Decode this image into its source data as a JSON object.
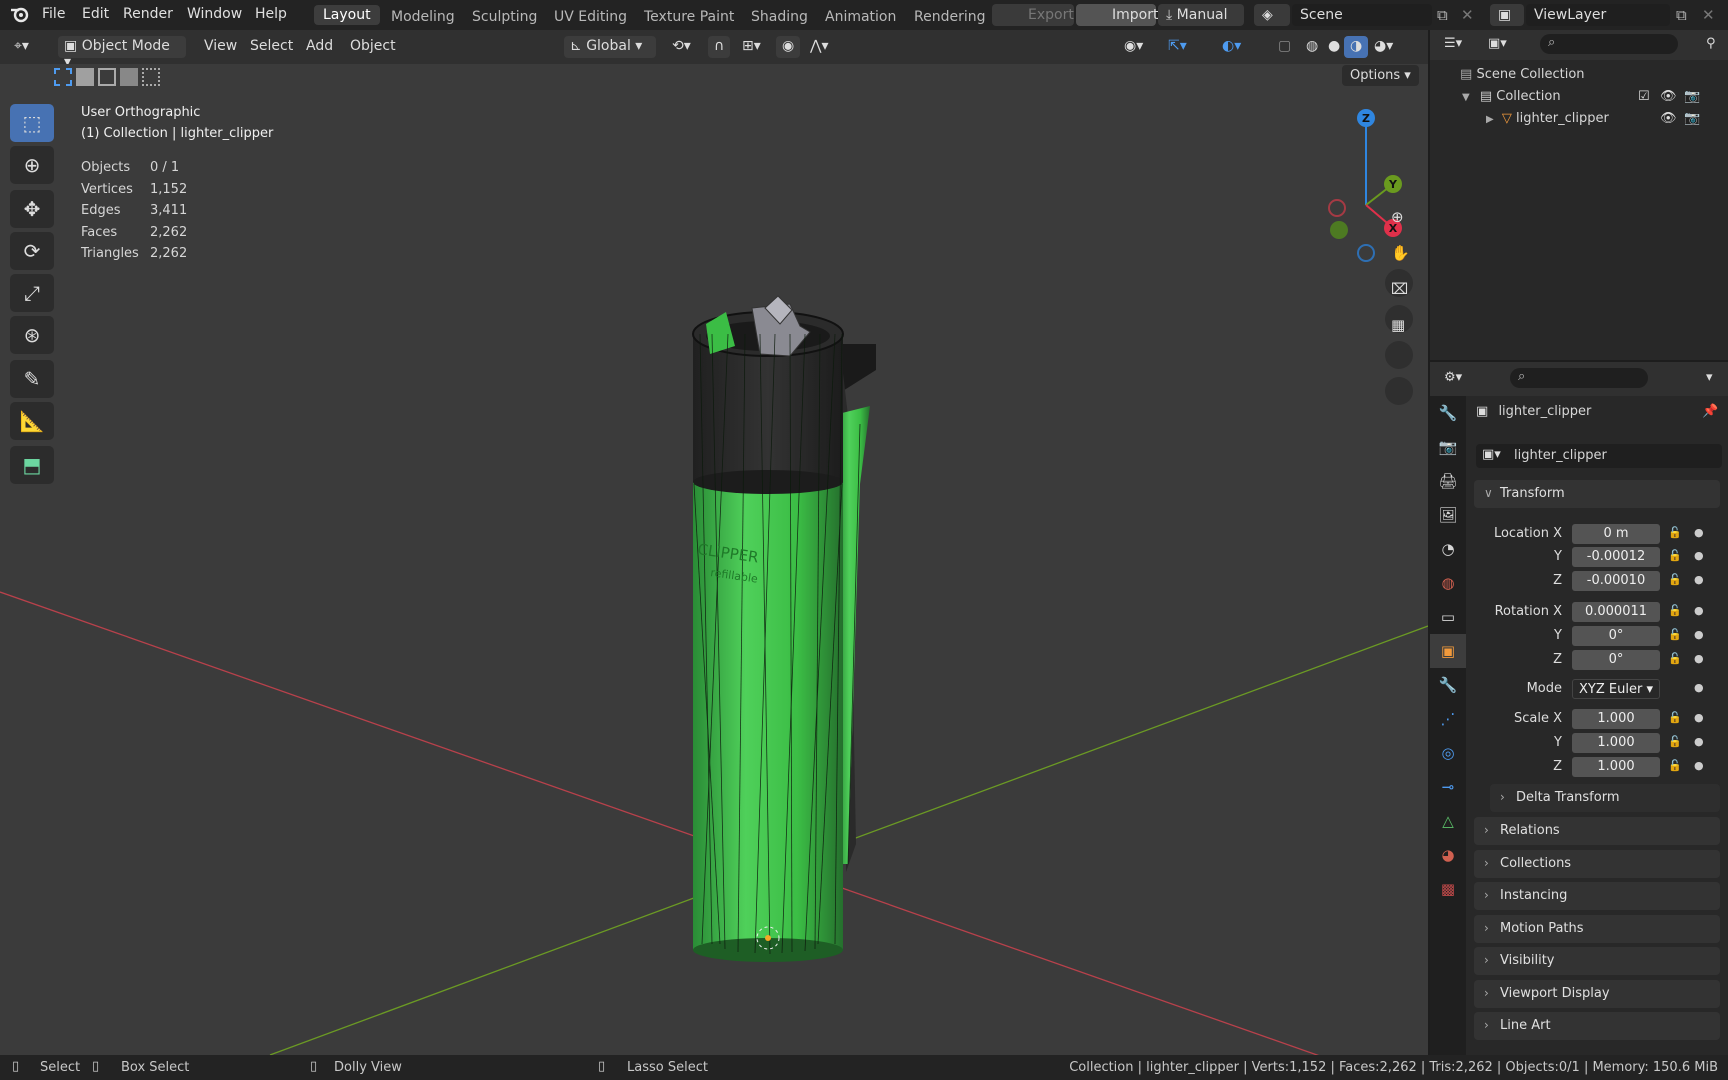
{
  "menu": {
    "logo": "blender-logo",
    "items": [
      "File",
      "Edit",
      "Render",
      "Window",
      "Help"
    ]
  },
  "workspaces": {
    "active": "Layout",
    "items": [
      "Modeling",
      "Sculpting",
      "UV Editing",
      "Texture Paint",
      "Shading",
      "Animation",
      "Rendering"
    ]
  },
  "topright": {
    "export": "Export",
    "import": "Import",
    "manual": "Manual",
    "scene": "Scene",
    "view_layer": "ViewLayer"
  },
  "vheader": {
    "mode": "Object Mode",
    "view": "View",
    "select": "Select",
    "add": "Add",
    "object": "Object",
    "orientation": "Global",
    "options": "Options"
  },
  "overlay": {
    "view_name": "User Orthographic",
    "collection": "(1) Collection | lighter_clipper",
    "stats": [
      {
        "label": "Objects",
        "value": "0 / 1"
      },
      {
        "label": "Vertices",
        "value": "1,152"
      },
      {
        "label": "Edges",
        "value": "3,411"
      },
      {
        "label": "Faces",
        "value": "2,262"
      },
      {
        "label": "Triangles",
        "value": "2,262"
      }
    ]
  },
  "gizmo": {
    "z": "Z",
    "y": "Y",
    "x": "X"
  },
  "model": {
    "label_top": "CLIPPER",
    "label_bottom": "refillable"
  },
  "outliner": {
    "scene_collection": "Scene Collection",
    "collection": "Collection",
    "object": "lighter_clipper"
  },
  "properties": {
    "object_name": "lighter_clipper",
    "data_name": "lighter_clipper",
    "transform_title": "Transform",
    "location_label": "Location X",
    "location": [
      "0 m",
      "-0.00012",
      "-0.00010"
    ],
    "rotation_label": "Rotation X",
    "rotation": [
      "0.000011",
      "0°",
      "0°"
    ],
    "mode_label": "Mode",
    "mode_value": "XYZ Euler",
    "scale_label": "Scale X",
    "scale": [
      "1.000",
      "1.000",
      "1.000"
    ],
    "axis_y": "Y",
    "axis_z": "Z",
    "delta": "Delta Transform",
    "sections": [
      "Relations",
      "Collections",
      "Instancing",
      "Motion Paths",
      "Visibility",
      "Viewport Display",
      "Line Art"
    ]
  },
  "status": {
    "select": "Select",
    "box_select": "Box Select",
    "dolly": "Dolly View",
    "lasso": "Lasso Select",
    "info": "Collection | lighter_clipper | Verts:1,152 | Faces:2,262 | Tris:2,262 | Objects:0/1 | Memory: 150.6 MiB"
  },
  "colors": {
    "accent": "#4772b3",
    "x_axis": "#c8404a",
    "y_axis": "#6a9a1f",
    "z_axis": "#2f86e0",
    "body_green": "#3fc24d"
  }
}
